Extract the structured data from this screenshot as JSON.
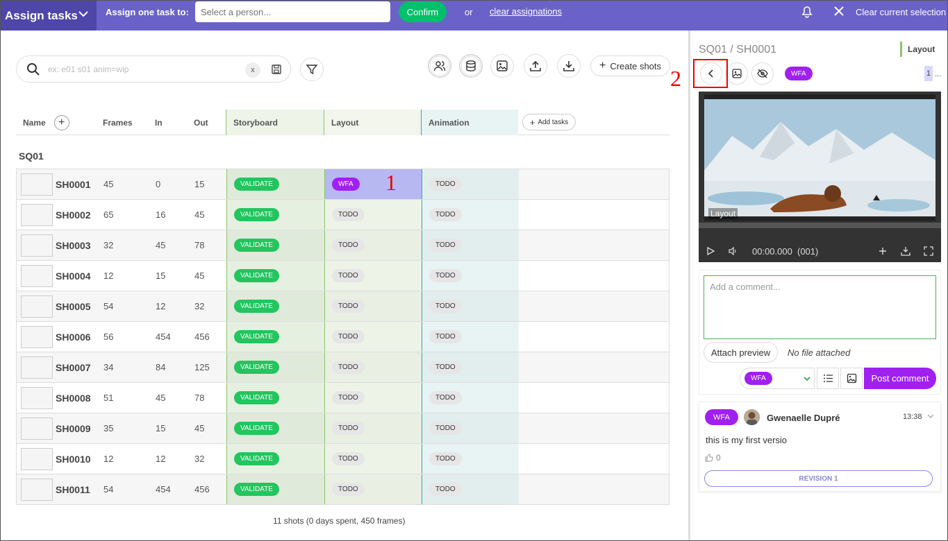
{
  "topbar": {
    "title": "Assign tasks",
    "assign_label": "Assign one task to:",
    "person_placeholder": "Select a person...",
    "confirm": "Confirm",
    "or": "or",
    "clear_assignations": "clear assignations",
    "clear_selection": "Clear current selection"
  },
  "search": {
    "placeholder": "ex: e01 s01 anim=wip",
    "clear": "x"
  },
  "toolbar": {
    "create_shots": "Create shots"
  },
  "table": {
    "headers": {
      "name": "Name",
      "frames": "Frames",
      "in": "In",
      "out": "Out",
      "storyboard": "Storyboard",
      "layout": "Layout",
      "animation": "Animation",
      "add_tasks": "Add tasks"
    },
    "sequence": "SQ01",
    "rows": [
      {
        "name": "SH0001",
        "frames": "45",
        "in": "0",
        "out": "15",
        "storyboard": "VALIDATE",
        "layout": "WFA",
        "animation": "TODO"
      },
      {
        "name": "SH0002",
        "frames": "65",
        "in": "16",
        "out": "45",
        "storyboard": "VALIDATE",
        "layout": "TODO",
        "animation": "TODO"
      },
      {
        "name": "SH0003",
        "frames": "32",
        "in": "45",
        "out": "78",
        "storyboard": "VALIDATE",
        "layout": "TODO",
        "animation": "TODO"
      },
      {
        "name": "SH0004",
        "frames": "12",
        "in": "15",
        "out": "45",
        "storyboard": "VALIDATE",
        "layout": "TODO",
        "animation": "TODO"
      },
      {
        "name": "SH0005",
        "frames": "54",
        "in": "12",
        "out": "32",
        "storyboard": "VALIDATE",
        "layout": "TODO",
        "animation": "TODO"
      },
      {
        "name": "SH0006",
        "frames": "56",
        "in": "454",
        "out": "456",
        "storyboard": "VALIDATE",
        "layout": "TODO",
        "animation": "TODO"
      },
      {
        "name": "SH0007",
        "frames": "34",
        "in": "84",
        "out": "125",
        "storyboard": "VALIDATE",
        "layout": "TODO",
        "animation": "TODO"
      },
      {
        "name": "SH0008",
        "frames": "51",
        "in": "45",
        "out": "78",
        "storyboard": "VALIDATE",
        "layout": "TODO",
        "animation": "TODO"
      },
      {
        "name": "SH0009",
        "frames": "35",
        "in": "15",
        "out": "45",
        "storyboard": "VALIDATE",
        "layout": "TODO",
        "animation": "TODO"
      },
      {
        "name": "SH0010",
        "frames": "12",
        "in": "12",
        "out": "32",
        "storyboard": "VALIDATE",
        "layout": "TODO",
        "animation": "TODO"
      },
      {
        "name": "SH0011",
        "frames": "54",
        "in": "454",
        "out": "456",
        "storyboard": "VALIDATE",
        "layout": "TODO",
        "animation": "TODO"
      }
    ],
    "footer": "11 shots (0 days spent, 450 frames)"
  },
  "annotations": {
    "one": "1",
    "two": "2"
  },
  "panel": {
    "breadcrumb": "SQ01 / SH0001",
    "task_type": "Layout",
    "status": "WFA",
    "revision_tab": "1",
    "revision_more": "...",
    "player": {
      "overlay_label": "Layout",
      "time": "00:00.000",
      "frame": "(001)"
    },
    "comment_placeholder": "Add a comment...",
    "attach_preview": "Attach preview",
    "no_file": "No file attached",
    "status_select": "WFA",
    "post_comment": "Post comment",
    "entry": {
      "status": "WFA",
      "author": "Gwenaelle Dupré",
      "time": "13:38",
      "text": "this is my first versio",
      "likes": "0",
      "revision": "REVISION 1"
    }
  },
  "colors": {
    "topbar": "#6a62c8",
    "validate": "#22c55e",
    "wfa": "#a020f0",
    "highlight": "#b7b7f2",
    "annotation": "#e00000"
  }
}
